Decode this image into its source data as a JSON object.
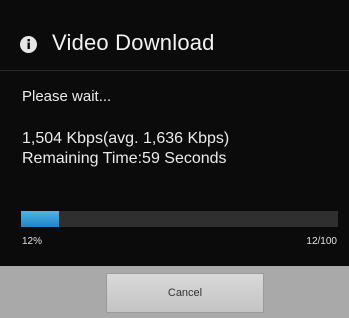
{
  "dialog": {
    "title": "Video Download",
    "icon": "info-icon",
    "message": "Please wait...",
    "rate_text": "1,504 Kbps(avg. 1,636 Kbps)",
    "remaining_text": "Remaining Time:59 Seconds"
  },
  "progress": {
    "percent_label": "12%",
    "count_label": "12/100",
    "fraction": 0.12,
    "fill_color": "#33a0d8"
  },
  "buttons": {
    "cancel_label": "Cancel"
  }
}
